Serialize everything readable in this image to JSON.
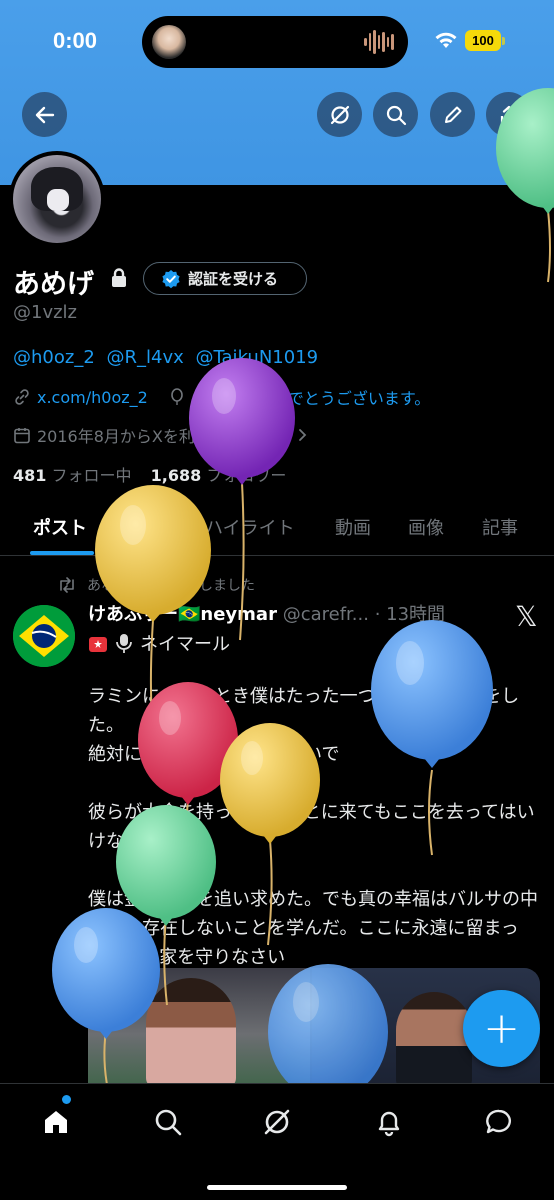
{
  "status_bar": {
    "time": "0:00",
    "battery": "100"
  },
  "header": {
    "back_icon": "arrow-left-icon",
    "actions": [
      "grok-icon",
      "search-icon",
      "edit-icon",
      "share-icon"
    ]
  },
  "profile": {
    "display_name": "あめげ",
    "verify_button": "認証を受ける",
    "handle": "@1vzlz",
    "mentions": [
      "@h0oz_2",
      "@R_l4vx",
      "@TaikuN1019"
    ],
    "website": "x.com/h0oz_2",
    "birthday_message": "お誕生日おめでとうございます。",
    "joined": "2016年8月からXを利用しています",
    "following_count": "481",
    "following_label": "フォロー中",
    "followers_count": "1,688",
    "followers_label": "フォロワー"
  },
  "tabs": [
    "ポスト",
    "返信",
    "ハイライト",
    "動画",
    "画像",
    "記事"
  ],
  "post": {
    "repost_label": "あなたがリポストしました",
    "author_name": "けあふりー🇧🇷neymar",
    "author_handle": "@carefr...",
    "time": "13時間",
    "line2": "ネイマール",
    "body": [
      "ラミンに会ったとき僕はたった一つのアドバイスをした。\n絶対にバルセロナを去らないで",
      "彼らが大金を持って君のもとに来てもここを去ってはいけない。",
      "僕は金と栄光を追い求めた。でも真の幸福はバルサの中にしか存在しないことを学んだ。ここに永遠に留まって、君の家を守りなさい"
    ]
  },
  "fab": {
    "label": "+"
  },
  "bottom_nav": [
    "home-icon",
    "search-icon",
    "grok-icon",
    "bell-icon",
    "message-icon"
  ],
  "colors": {
    "accent": "#1d9bf0",
    "banner": "#4a9fea",
    "background": "#000000",
    "muted": "#71767b"
  }
}
